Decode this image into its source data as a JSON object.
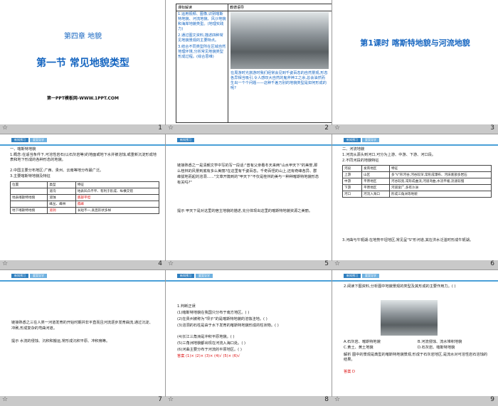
{
  "slides": [
    {
      "number": "1",
      "chapter": "第四章 地貌",
      "title": "第一节 常见地貌类型",
      "footer": "第一PPT模板网-WWW.1PPT.COM"
    },
    {
      "number": "2",
      "left_header": "课标解读",
      "right_header": "教德语导",
      "left_text": [
        "1.运用视频、图像,识别喀斯特地貌、河流地貌、风沙地貌和海岸地貌类型。(地理实践力)",
        "2.通过图文资料,描述四种常见地貌景观的主要特点。",
        "3.结合不同类型所在区域自然地理环境,分析常见地貌类型形成过程。(综合思维)"
      ],
      "right_text": "在周游时光旅游时我们经常会见到千姿百态的自然景观,形态各异相当吸引,令人感叹大自然的鬼斧神工之余,总会油然而生出一个个问题——这种千差万别的地貌类型是如何形成的呢?"
    },
    {
      "number": "3",
      "title": "第1课时 喀斯特地貌与河流地貌"
    },
    {
      "number": "4",
      "tabs": [
        "新知预习",
        "要案导学"
      ],
      "heading": "一、喀斯特地貌",
      "p1": "1.概念:在适当条件下,可溶性岩石(以石灰岩等)的地面或地下水并被溶蚀,或重新沉淀形成地表和地下形成的各种形态的地貌。",
      "p2": "2.中国主要分布地区:广西、贵州、云南等地分布最广泛。",
      "p3": "3.主要喀斯特地貌及特征",
      "table_headers": [
        "位置",
        "类型",
        "特征"
      ],
      "table_rows": [
        [
          "",
          "溶沟",
          "地表凹凸不平、有利于形成、纵横交错"
        ],
        [
          "地表喀斯特地貌",
          "溶蚀",
          "底部平坦"
        ],
        [
          "",
          "峰丛、峰林",
          "孤峰"
        ],
        [
          "地下喀斯特地貌",
          "溶洞",
          "长短不一,高且形状多样"
        ]
      ]
    },
    {
      "number": "5",
      "tabs": [
        "新知预习"
      ],
      "body": "链接熟悉之一是清朝文学中写的写一段话:\"曾有父亲看冬天来两\"山水甲天下\"的美誉,那么桂林的风景到底有多么美丽?在这里有千姿百态。千奇百怪的山上,还有奇峰各异、群峰拔地而起的溶洞……\"文章开篇到的\"甲天下\"不仅是桂林的美与一种种喀斯特地貌形态有关吗?\"",
      "tip": "提示 甲天下是对这里的宿主地貌的描述,充分体现出这里的喀斯特地貌资源之美丽。"
    },
    {
      "number": "6",
      "tabs": [
        "新知预习",
        "要案导学"
      ],
      "heading": "二、河流地貌",
      "p1": "1.河流从源头到河口,可分为上游、中游、下游、河口段。",
      "p2": "2.不同河段的地貌特征",
      "table_headers": [
        "河段",
        "发育地区",
        "特征"
      ],
      "table_rows": [
        [
          "上游",
          "山区",
          "多\"V\"形河谷,河谷较深,常形成瀑布、河床底部多岩石"
        ],
        [
          "中游",
          "平原地区",
          "河谷较宽,常形成曲流,河道弯曲,水流平缓,流速较慢"
        ],
        [
          "下游",
          "平原地区",
          "河道宽广,多有沙洲"
        ],
        [
          "河口",
          "河流入海口",
          "形成三角洲等地貌"
        ]
      ],
      "p3": "3.河曲与牛轭湖:在地势平坦地区,常见呈\"S\"形河道,其在洪水泛滥时形成牛轭湖。"
    },
    {
      "number": "7",
      "tabs": [
        "新知预习",
        "要案导学"
      ],
      "body": "链接熟悉之三在人类一河道发育的开始时期并非平直而且河流逐步发育曲流,通过沉淀、冲刷,形成复杂的弯曲河道。",
      "tip": "提示 水流的侵蚀、沉积和搬运,常形成沉积平原、冲积扇等。"
    },
    {
      "number": "8",
      "tabs": [
        "新知预习",
        "要案导学"
      ],
      "heading": "1.判断正误",
      "items": [
        "(1)喀斯特地貌在我国只分布于南方地区。( )",
        "(2)在贵州被称为\"坝子\"的是喀斯特地貌的溶蚀洼地。( )",
        "(3)溶洞的石柱是由于水下发育的喀斯特地貌形成的柱状物。( )",
        "(4)长江三角洲是冲积平原地貌。( )",
        "(5)三角洲地貌都出现在河流入海口处。( )",
        "(6)河曲主要分布于河流的平原地区。( )"
      ],
      "answer": "答案 (1)× (2)× (3)× (4)√ (5)× (6)√"
    },
    {
      "number": "9",
      "tabs": [
        "新知预习",
        "要案导学"
      ],
      "question": "2.阅读下图资料,分析图中地貌景观的类型及其形成的主要作用力。( )",
      "options": [
        "A.石灰岩、喀斯特地貌",
        "B.河流侵蚀、流水堆积地貌",
        "C.黄土、黄土地貌",
        "D.石灰岩、喀斯特地貌"
      ],
      "analysis": "解析 图中的景观是典型的喀斯特地貌景观,形成于石灰岩地区,是流水对可溶性岩石溶蚀的结果。",
      "answer": "答案 D"
    }
  ],
  "colors": {
    "accent": "#2f7fbf",
    "title_blue": "#1565c0",
    "red": "#d11",
    "grid_bg": "#c9c9c9"
  },
  "footer_icon": "star-icon"
}
